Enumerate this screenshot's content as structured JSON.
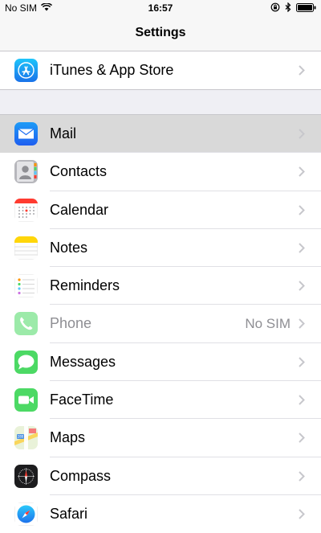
{
  "status_bar": {
    "carrier": "No SIM",
    "time": "16:57",
    "wifi_icon": "wifi-icon",
    "rotation_lock_icon": "rotation-lock-icon",
    "bluetooth_icon": "bluetooth-icon",
    "battery_icon": "battery-icon"
  },
  "nav": {
    "title": "Settings"
  },
  "groups": [
    [
      {
        "label": "iTunes & App Store",
        "icon": "app-store-icon"
      }
    ],
    [
      {
        "label": "Mail",
        "icon": "mail-icon",
        "highlighted": true
      },
      {
        "label": "Contacts",
        "icon": "contacts-icon"
      },
      {
        "label": "Calendar",
        "icon": "calendar-icon"
      },
      {
        "label": "Notes",
        "icon": "notes-icon"
      },
      {
        "label": "Reminders",
        "icon": "reminders-icon"
      },
      {
        "label": "Phone",
        "icon": "phone-icon",
        "value": "No SIM",
        "disabled": true
      },
      {
        "label": "Messages",
        "icon": "messages-icon"
      },
      {
        "label": "FaceTime",
        "icon": "facetime-icon"
      },
      {
        "label": "Maps",
        "icon": "maps-icon"
      },
      {
        "label": "Compass",
        "icon": "compass-icon"
      },
      {
        "label": "Safari",
        "icon": "safari-icon"
      }
    ]
  ],
  "colors": {
    "background": "#efeff4",
    "separator": "#c8c7cc",
    "highlight": "#d9d9d9",
    "secondary_text": "#8e8e93",
    "chevron": "#c7c7cc"
  }
}
